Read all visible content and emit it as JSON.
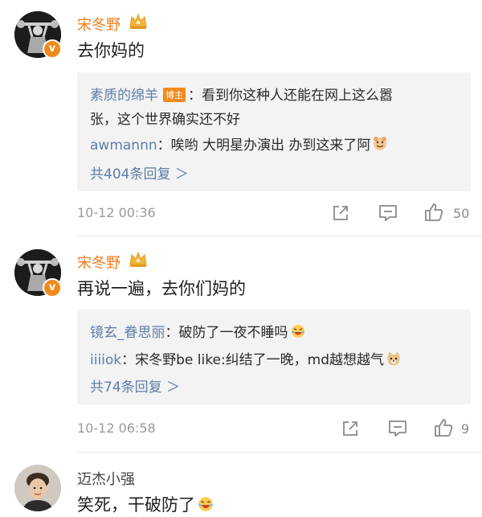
{
  "comments": [
    {
      "author": "宋冬野",
      "text": "去你妈的",
      "replies": [
        {
          "name": "素质的绵羊",
          "badge": "博主",
          "sep": "：",
          "text": "看到你这种人还能在网上这么嚣",
          "text2": "张，这个世界确实还不好"
        },
        {
          "name": "awmannn",
          "sep": "：",
          "text": "唉哟 大明星办演出 办到这来了阿"
        }
      ],
      "more_replies": "共404条回复 ＞",
      "time": "10-12 00:36",
      "likes": "50"
    },
    {
      "author": "宋冬野",
      "text": "再说一遍，去你们妈的",
      "replies": [
        {
          "name": "镜玄_眷思丽",
          "sep": "：",
          "text": "破防了一夜不睡吗"
        },
        {
          "name": "iiiiok",
          "sep": "：",
          "text": "宋冬野be like:纠结了一晚，md越想越气"
        }
      ],
      "more_replies": "共74条回复 ＞",
      "time": "10-12 06:58",
      "likes": "9"
    },
    {
      "author": "迈杰小强",
      "text": "笑死，干破防了"
    }
  ],
  "icons": {
    "verified": "v-verified-icon",
    "crown": "crown-icon",
    "forward": "forward-icon",
    "reply": "comment-icon",
    "like": "thumbs-up-icon"
  },
  "colors": {
    "username": "#f07b1c",
    "reply_name": "#5c7ea9",
    "badge_bg": "#f08a1c",
    "reply_box_bg": "#f3f3f3"
  }
}
